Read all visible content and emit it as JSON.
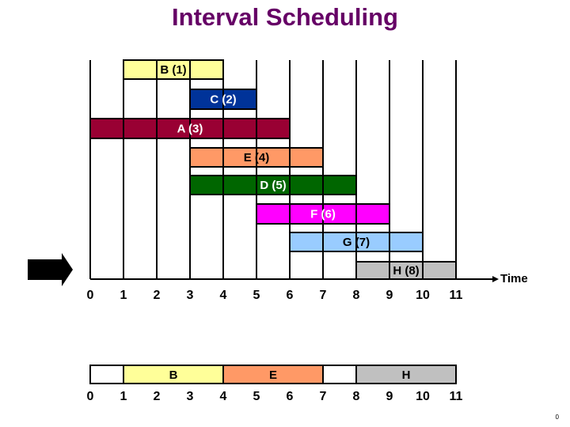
{
  "title": "Interval Scheduling",
  "axis_label": "Time",
  "page_number": "0",
  "time_ticks": [
    "0",
    "1",
    "2",
    "3",
    "4",
    "5",
    "6",
    "7",
    "8",
    "9",
    "10",
    "11"
  ],
  "jobs": [
    {
      "name": "B",
      "label": "B (1)",
      "start": 1,
      "end": 4,
      "fill": "#FFFF99",
      "text_color": "#000000"
    },
    {
      "name": "C",
      "label": "C (2)",
      "start": 3,
      "end": 5,
      "fill": "#003399",
      "text_color": "#FFFFFF"
    },
    {
      "name": "A",
      "label": "A (3)",
      "start": 0,
      "end": 6,
      "fill": "#990033",
      "text_color": "#FFFFFF"
    },
    {
      "name": "E",
      "label": "E (4)",
      "start": 3,
      "end": 7,
      "fill": "#FF9966",
      "text_color": "#000000"
    },
    {
      "name": "D",
      "label": "D (5)",
      "start": 3,
      "end": 8,
      "fill": "#006600",
      "text_color": "#FFFFFF"
    },
    {
      "name": "F",
      "label": "F (6)",
      "start": 5,
      "end": 9,
      "fill": "#FF00FF",
      "text_color": "#FFFFFF"
    },
    {
      "name": "G",
      "label": "G (7)",
      "start": 6,
      "end": 10,
      "fill": "#99CCFF",
      "text_color": "#000000"
    },
    {
      "name": "H",
      "label": "H (8)",
      "start": 8,
      "end": 11,
      "fill": "#C0C0C0",
      "text_color": "#000000"
    }
  ],
  "schedule": {
    "segments": [
      {
        "label": "",
        "start": 0,
        "end": 1,
        "fill": "#FFFFFF"
      },
      {
        "label": "B",
        "start": 1,
        "end": 4,
        "fill": "#FFFF99"
      },
      {
        "label": "E",
        "start": 4,
        "end": 7,
        "fill": "#FF9966"
      },
      {
        "label": "",
        "start": 7,
        "end": 8,
        "fill": "#FFFFFF"
      },
      {
        "label": "H",
        "start": 8,
        "end": 11,
        "fill": "#C0C0C0"
      }
    ],
    "ticks": [
      "0",
      "1",
      "2",
      "3",
      "4",
      "5",
      "6",
      "7",
      "8",
      "9",
      "10",
      "11"
    ]
  },
  "chart_data": {
    "type": "gantt",
    "title": "Interval Scheduling",
    "xlabel": "Time",
    "xlim": [
      0,
      11
    ],
    "series": [
      {
        "name": "B (1)",
        "start": 1,
        "end": 4
      },
      {
        "name": "C (2)",
        "start": 3,
        "end": 5
      },
      {
        "name": "A (3)",
        "start": 0,
        "end": 6
      },
      {
        "name": "E (4)",
        "start": 3,
        "end": 7
      },
      {
        "name": "D (5)",
        "start": 3,
        "end": 8
      },
      {
        "name": "F (6)",
        "start": 5,
        "end": 9
      },
      {
        "name": "G (7)",
        "start": 6,
        "end": 10
      },
      {
        "name": "H (8)",
        "start": 8,
        "end": 11
      }
    ],
    "selected_schedule": [
      {
        "name": "B",
        "start": 1,
        "end": 4
      },
      {
        "name": "E",
        "start": 4,
        "end": 7
      },
      {
        "name": "H",
        "start": 8,
        "end": 11
      }
    ]
  }
}
